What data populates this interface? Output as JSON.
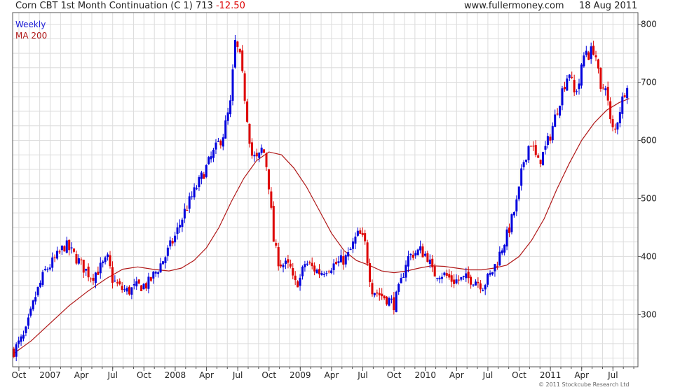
{
  "header": {
    "symbol": "Corn CBT 1st Month Continuation (C 1)",
    "last": "713",
    "change": "-12.50",
    "site": "www.fullermoney.com",
    "date": "18 Aug 2011"
  },
  "legend": {
    "weekly": "Weekly",
    "ma": "MA 200"
  },
  "copyright": "© 2011 Stockcube Research Ltd",
  "colors": {
    "up": "#0000dd",
    "down": "#dd0000",
    "ma": "#b01818",
    "grid": "#dcdcdc"
  },
  "chart_data": {
    "type": "candlestick",
    "period": "Weekly",
    "ylim": [
      210,
      820
    ],
    "yticks": [
      300,
      400,
      500,
      600,
      700,
      800
    ],
    "xticks": [
      {
        "label": "Oct",
        "t": 2006.75
      },
      {
        "label": "2007",
        "t": 2007.0
      },
      {
        "label": "Apr",
        "t": 2007.25
      },
      {
        "label": "Jul",
        "t": 2007.5
      },
      {
        "label": "Oct",
        "t": 2007.75
      },
      {
        "label": "2008",
        "t": 2008.0
      },
      {
        "label": "Apr",
        "t": 2008.25
      },
      {
        "label": "Jul",
        "t": 2008.5
      },
      {
        "label": "Oct",
        "t": 2008.75
      },
      {
        "label": "2009",
        "t": 2009.0
      },
      {
        "label": "Apr",
        "t": 2009.25
      },
      {
        "label": "Jul",
        "t": 2009.5
      },
      {
        "label": "Oct",
        "t": 2009.75
      },
      {
        "label": "2010",
        "t": 2010.0
      },
      {
        "label": "Apr",
        "t": 2010.25
      },
      {
        "label": "Jul",
        "t": 2010.5
      },
      {
        "label": "Oct",
        "t": 2010.75
      },
      {
        "label": "2011",
        "t": 2011.0
      },
      {
        "label": "Apr",
        "t": 2011.25
      },
      {
        "label": "Jul",
        "t": 2011.5
      }
    ],
    "xlim": [
      2006.7,
      2011.7
    ],
    "price_path": [
      [
        2006.71,
        238
      ],
      [
        2006.8,
        265
      ],
      [
        2006.88,
        330
      ],
      [
        2006.96,
        375
      ],
      [
        2007.04,
        395
      ],
      [
        2007.12,
        420
      ],
      [
        2007.2,
        400
      ],
      [
        2007.27,
        380
      ],
      [
        2007.33,
        365
      ],
      [
        2007.4,
        380
      ],
      [
        2007.46,
        395
      ],
      [
        2007.5,
        360
      ],
      [
        2007.56,
        345
      ],
      [
        2007.62,
        340
      ],
      [
        2007.7,
        348
      ],
      [
        2007.78,
        352
      ],
      [
        2007.85,
        375
      ],
      [
        2007.92,
        400
      ],
      [
        2008.0,
        435
      ],
      [
        2008.08,
        480
      ],
      [
        2008.15,
        510
      ],
      [
        2008.23,
        545
      ],
      [
        2008.31,
        580
      ],
      [
        2008.38,
        608
      ],
      [
        2008.44,
        660
      ],
      [
        2008.48,
        770
      ],
      [
        2008.52,
        740
      ],
      [
        2008.57,
        650
      ],
      [
        2008.61,
        575
      ],
      [
        2008.66,
        565
      ],
      [
        2008.7,
        590
      ],
      [
        2008.74,
        545
      ],
      [
        2008.79,
        420
      ],
      [
        2008.83,
        390
      ],
      [
        2008.88,
        385
      ],
      [
        2008.92,
        380
      ],
      [
        2008.95,
        350
      ],
      [
        2009.0,
        362
      ],
      [
        2009.04,
        390
      ],
      [
        2009.1,
        380
      ],
      [
        2009.16,
        372
      ],
      [
        2009.22,
        382
      ],
      [
        2009.3,
        388
      ],
      [
        2009.38,
        400
      ],
      [
        2009.44,
        430
      ],
      [
        2009.47,
        440
      ],
      [
        2009.52,
        420
      ],
      [
        2009.57,
        345
      ],
      [
        2009.63,
        335
      ],
      [
        2009.69,
        328
      ],
      [
        2009.75,
        318
      ],
      [
        2009.8,
        350
      ],
      [
        2009.85,
        395
      ],
      [
        2009.9,
        405
      ],
      [
        2009.96,
        410
      ],
      [
        2010.02,
        400
      ],
      [
        2010.06,
        370
      ],
      [
        2010.12,
        372
      ],
      [
        2010.17,
        366
      ],
      [
        2010.22,
        358
      ],
      [
        2010.28,
        360
      ],
      [
        2010.34,
        362
      ],
      [
        2010.4,
        360
      ],
      [
        2010.46,
        350
      ],
      [
        2010.52,
        368
      ],
      [
        2010.58,
        395
      ],
      [
        2010.62,
        420
      ],
      [
        2010.66,
        440
      ],
      [
        2010.7,
        470
      ],
      [
        2010.74,
        500
      ],
      [
        2010.78,
        560
      ],
      [
        2010.84,
        600
      ],
      [
        2010.9,
        560
      ],
      [
        2010.95,
        580
      ],
      [
        2011.0,
        610
      ],
      [
        2011.05,
        650
      ],
      [
        2011.1,
        690
      ],
      [
        2011.15,
        720
      ],
      [
        2011.19,
        680
      ],
      [
        2011.23,
        700
      ],
      [
        2011.28,
        760
      ],
      [
        2011.31,
        745
      ],
      [
        2011.34,
        760
      ],
      [
        2011.37,
        740
      ],
      [
        2011.4,
        680
      ],
      [
        2011.44,
        700
      ],
      [
        2011.48,
        630
      ],
      [
        2011.51,
        610
      ],
      [
        2011.55,
        650
      ],
      [
        2011.6,
        690
      ],
      [
        2011.63,
        713
      ]
    ],
    "ma200": [
      [
        2006.71,
        233
      ],
      [
        2006.85,
        255
      ],
      [
        2007.0,
        285
      ],
      [
        2007.15,
        315
      ],
      [
        2007.3,
        340
      ],
      [
        2007.45,
        362
      ],
      [
        2007.58,
        378
      ],
      [
        2007.7,
        382
      ],
      [
        2007.82,
        378
      ],
      [
        2007.95,
        375
      ],
      [
        2008.05,
        380
      ],
      [
        2008.15,
        393
      ],
      [
        2008.25,
        415
      ],
      [
        2008.35,
        450
      ],
      [
        2008.45,
        495
      ],
      [
        2008.55,
        535
      ],
      [
        2008.65,
        565
      ],
      [
        2008.75,
        580
      ],
      [
        2008.85,
        575
      ],
      [
        2008.95,
        552
      ],
      [
        2009.05,
        520
      ],
      [
        2009.15,
        480
      ],
      [
        2009.25,
        440
      ],
      [
        2009.35,
        410
      ],
      [
        2009.45,
        393
      ],
      [
        2009.55,
        385
      ],
      [
        2009.65,
        375
      ],
      [
        2009.75,
        372
      ],
      [
        2009.85,
        375
      ],
      [
        2009.95,
        380
      ],
      [
        2010.05,
        384
      ],
      [
        2010.15,
        383
      ],
      [
        2010.25,
        380
      ],
      [
        2010.35,
        377
      ],
      [
        2010.45,
        377
      ],
      [
        2010.55,
        380
      ],
      [
        2010.65,
        385
      ],
      [
        2010.75,
        400
      ],
      [
        2010.85,
        428
      ],
      [
        2010.95,
        465
      ],
      [
        2011.05,
        515
      ],
      [
        2011.15,
        560
      ],
      [
        2011.25,
        600
      ],
      [
        2011.35,
        630
      ],
      [
        2011.45,
        652
      ],
      [
        2011.55,
        665
      ],
      [
        2011.63,
        672
      ]
    ]
  }
}
